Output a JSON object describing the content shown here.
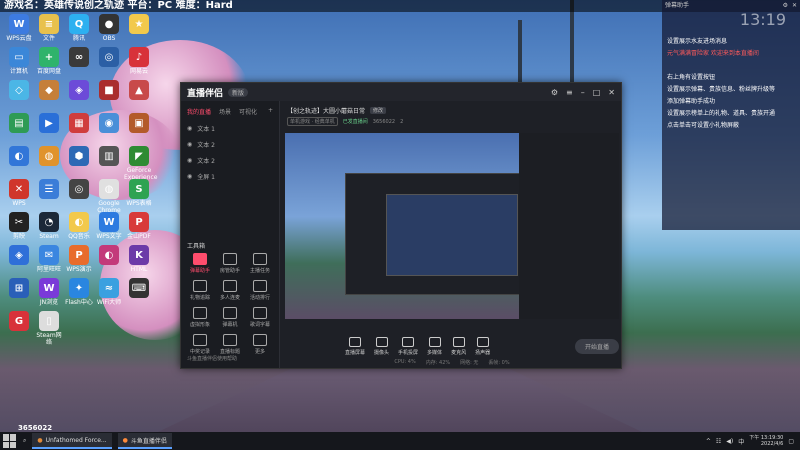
{
  "overlay": {
    "top_text": "游戏名：英雄传说创之轨迹  平台：PC  难度：Hard"
  },
  "desktop": {
    "room_id": "3656022",
    "icons": [
      {
        "label": "WPS云盘",
        "color": "#3d7be0",
        "glyph": "W"
      },
      {
        "label": "文件",
        "color": "#e8c14d",
        "glyph": "≡"
      },
      {
        "label": "腾讯",
        "color": "#2db0f0",
        "glyph": "Q"
      },
      {
        "label": "OBS",
        "color": "#333",
        "glyph": "●"
      },
      {
        "label": "",
        "color": "#f2c94c",
        "glyph": "★"
      },
      {
        "label": "计算机",
        "color": "#3b87d8",
        "glyph": "▭"
      },
      {
        "label": "百度网盘",
        "color": "#2fb36b",
        "glyph": "+"
      },
      {
        "label": "",
        "color": "#3a3a3a",
        "glyph": "∞"
      },
      {
        "label": "",
        "color": "#2b5fa5",
        "glyph": "◎"
      },
      {
        "label": "网易云",
        "color": "#d8323a",
        "glyph": "♪"
      },
      {
        "label": "",
        "color": "#4bb6e6",
        "glyph": "◇"
      },
      {
        "label": "",
        "color": "#c57f3a",
        "glyph": "◆"
      },
      {
        "label": "",
        "color": "#6c4bd8",
        "glyph": "◈"
      },
      {
        "label": "",
        "color": "#aa2e2e",
        "glyph": "■"
      },
      {
        "label": "",
        "color": "#c84a4a",
        "glyph": "▲"
      },
      {
        "label": "",
        "color": "#2e9b55",
        "glyph": "▤"
      },
      {
        "label": "",
        "color": "#2a6fd8",
        "glyph": "▶"
      },
      {
        "label": "",
        "color": "#d03d3d",
        "glyph": "▦"
      },
      {
        "label": "",
        "color": "#4a8fd8",
        "glyph": "◉"
      },
      {
        "label": "",
        "color": "#b35a2a",
        "glyph": "▣"
      },
      {
        "label": "",
        "color": "#3276d8",
        "glyph": "◐"
      },
      {
        "label": "",
        "color": "#e0932c",
        "glyph": "◍"
      },
      {
        "label": "",
        "color": "#2d69b5",
        "glyph": "⬢"
      },
      {
        "label": "",
        "color": "#555",
        "glyph": "▥"
      },
      {
        "label": "GeForce Experience",
        "color": "#2e8b33",
        "glyph": "◤"
      },
      {
        "label": "WPS",
        "color": "#d0362c",
        "glyph": "✕"
      },
      {
        "label": "",
        "color": "#3b7dd8",
        "glyph": "☰"
      },
      {
        "label": "",
        "color": "#444",
        "glyph": "◎"
      },
      {
        "label": "Google Chrome",
        "color": "#e0e0e0",
        "glyph": "◍"
      },
      {
        "label": "WPS表格",
        "color": "#2ea352",
        "glyph": "S"
      },
      {
        "label": "剪映",
        "color": "#222",
        "glyph": "✂"
      },
      {
        "label": "Steam",
        "color": "#1b2838",
        "glyph": "◔"
      },
      {
        "label": "QQ音乐",
        "color": "#f2c94c",
        "glyph": "◐"
      },
      {
        "label": "WPS文字",
        "color": "#2d7be0",
        "glyph": "W"
      },
      {
        "label": "金山PDF",
        "color": "#d83a3a",
        "glyph": "P"
      },
      {
        "label": "",
        "color": "#2f6fd8",
        "glyph": "◈"
      },
      {
        "label": "阿里旺旺",
        "color": "#3a86e0",
        "glyph": "✉"
      },
      {
        "label": "WPS演示",
        "color": "#e86c2c",
        "glyph": "P"
      },
      {
        "label": "",
        "color": "#c33a7a",
        "glyph": "◐"
      },
      {
        "label": "HTML",
        "color": "#6c3aa8",
        "glyph": "K"
      },
      {
        "label": "",
        "color": "#2a5fb8",
        "glyph": "⊞"
      },
      {
        "label": "JN浏览",
        "color": "#7a3ad8",
        "glyph": "W"
      },
      {
        "label": "Flash中心",
        "color": "#2a86e0",
        "glyph": "✦"
      },
      {
        "label": "WiFi大师",
        "color": "#3aa0e0",
        "glyph": "≈"
      },
      {
        "label": "",
        "color": "#333",
        "glyph": "⌨"
      },
      {
        "label": "",
        "color": "#d8323a",
        "glyph": "G"
      },
      {
        "label": "Steam网络",
        "color": "#ddd",
        "glyph": "▯"
      }
    ]
  },
  "app": {
    "logo": "直播伴侣",
    "version": "新版",
    "tabs": [
      "我的直播",
      "场景",
      "可视化"
    ],
    "scenes": [
      "文本 1",
      "文本 2",
      "文本 2",
      "全屏 1"
    ],
    "tools_label": "工具箱",
    "tools": [
      "弹幕助手",
      "房管助手",
      "主播任务",
      "礼物追踪",
      "多人连麦",
      "活动排行",
      "虚拟形象",
      "弹幕机",
      "歌词字幕",
      "中奖记录",
      "直播标题",
      "更多"
    ],
    "bottom_tip": "斗鱼直播伴侣使用帮助",
    "room": {
      "title": "【创之轨迹】大圆小蘑菇日常",
      "tag": "修改",
      "category": "单机游戏 · 经典单机",
      "status": "已发直播间",
      "room_no": "3656022",
      "likes": "2"
    },
    "controls": [
      "直播屏幕",
      "摄像头",
      "手机投屏",
      "多媒体",
      "麦克风",
      "扬声器"
    ],
    "start_label": "开始直播",
    "status_bar": [
      "CPU: 4%",
      "内存: 42%",
      "网络: 无",
      "丢帧: 0%"
    ]
  },
  "panel": {
    "header": "弹幕助手",
    "clock": "13:19",
    "messages": [
      {
        "text": "设置展示水友进场消息",
        "highlight": false
      },
      {
        "text": "元气满满冒险家 欢迎来到本直播间",
        "highlight": true
      },
      {
        "text": "右上角有设置按钮",
        "highlight": false
      },
      {
        "text": "设置展示弹幕、贵族信息、粉丝牌升级等",
        "highlight": false
      },
      {
        "text": "添加弹幕助手成功",
        "highlight": false
      },
      {
        "text": "设置展示榜单上的礼物、道具、贵族开通",
        "highlight": false
      },
      {
        "text": "点击单击可设置小礼物屏蔽",
        "highlight": false
      }
    ]
  },
  "taskbar": {
    "items": [
      "Unfathomed Force...",
      "斗鱼直播伴侣"
    ],
    "time": "13:19:30",
    "date": "2022/4/6",
    "lang": "中",
    "weather": "下午"
  }
}
